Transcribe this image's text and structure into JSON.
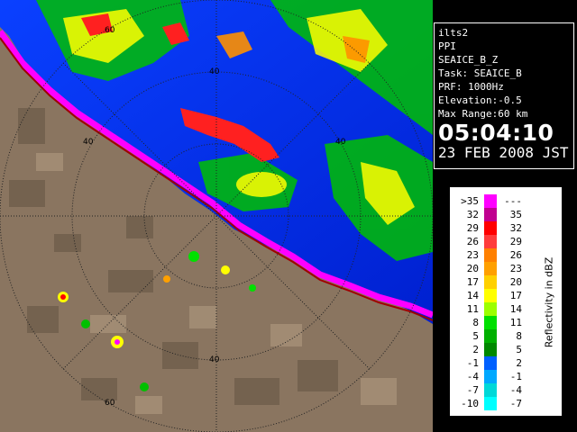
{
  "radar": {
    "range_ring_labels": [
      "60",
      "40",
      "40",
      "40",
      "40",
      "60"
    ]
  },
  "info": {
    "site": "ilts2",
    "scan_type": "PPI",
    "product": "SEAICE_B_Z",
    "task": "Task: SEAICE_B",
    "prf": "PRF: 1000Hz",
    "elevation": "Elevation:-0.5",
    "max_range": "Max Range:60 km",
    "time": "05:04:10",
    "date": "23 FEB 2008 JST"
  },
  "legend": {
    "unit_label": "Reflectivity in dBZ",
    "rows": [
      {
        "lo": ">35",
        "hi": "---",
        "color": "#ff00ff"
      },
      {
        "lo": "32",
        "hi": "35",
        "color": "#c00090"
      },
      {
        "lo": "29",
        "hi": "32",
        "color": "#ff0000"
      },
      {
        "lo": "26",
        "hi": "29",
        "color": "#ff3c3c"
      },
      {
        "lo": "23",
        "hi": "26",
        "color": "#ff8000"
      },
      {
        "lo": "20",
        "hi": "23",
        "color": "#ffa000"
      },
      {
        "lo": "17",
        "hi": "20",
        "color": "#ffd000"
      },
      {
        "lo": "14",
        "hi": "17",
        "color": "#ffff00"
      },
      {
        "lo": "11",
        "hi": "14",
        "color": "#9cff00"
      },
      {
        "lo": "8",
        "hi": "11",
        "color": "#00e000"
      },
      {
        "lo": "5",
        "hi": "8",
        "color": "#00b000"
      },
      {
        "lo": "2",
        "hi": "5",
        "color": "#008800"
      },
      {
        "lo": "-1",
        "hi": "2",
        "color": "#0060ff"
      },
      {
        "lo": "-4",
        "hi": "-1",
        "color": "#00a8ff"
      },
      {
        "lo": "-7",
        "hi": "-4",
        "color": "#00d8d8"
      },
      {
        "lo": "-10",
        "hi": "-7",
        "color": "#00ffff"
      }
    ]
  }
}
